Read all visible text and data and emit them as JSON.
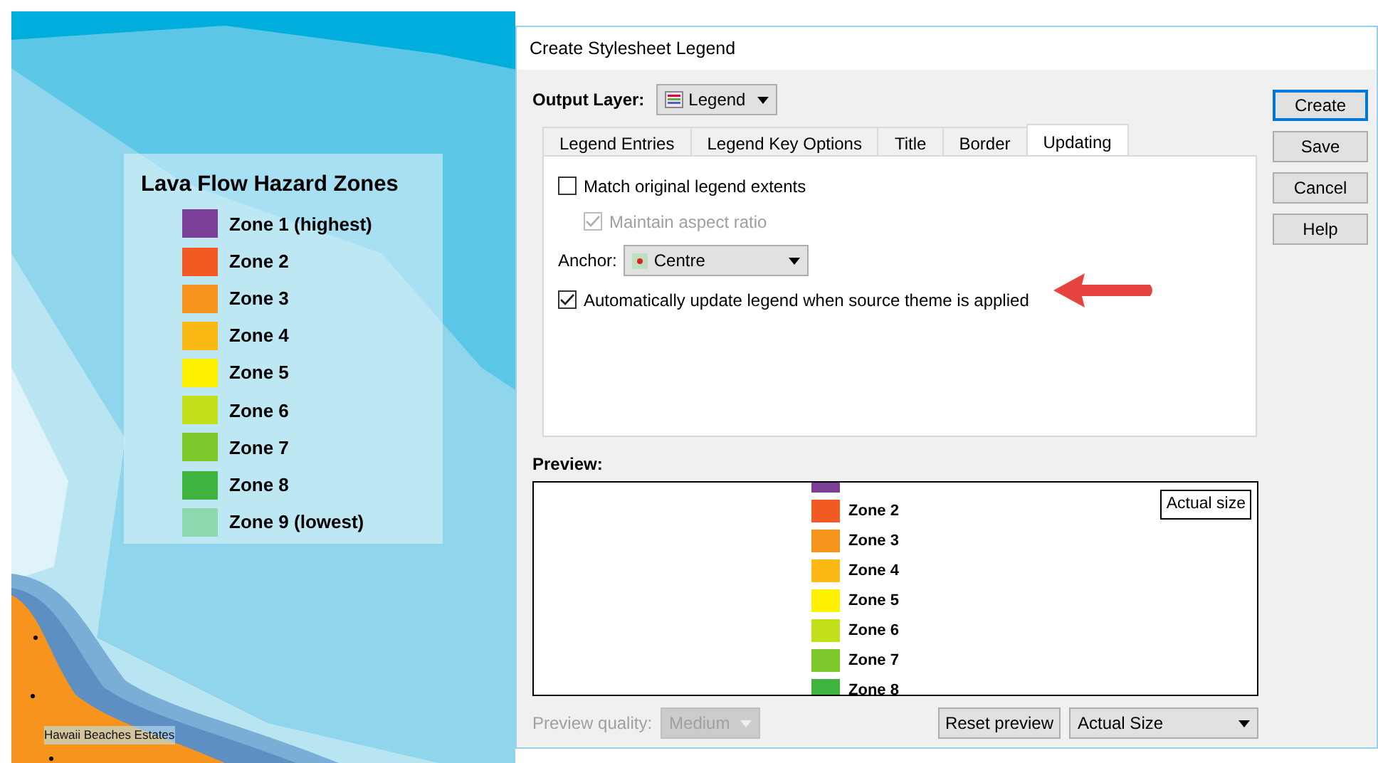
{
  "map": {
    "legend": {
      "title": "Lava Flow Hazard Zones",
      "entries": [
        {
          "label": "Zone 1 (highest)",
          "color": "#7b3f98"
        },
        {
          "label": "Zone 2",
          "color": "#f15a22"
        },
        {
          "label": "Zone 3",
          "color": "#f7941d"
        },
        {
          "label": "Zone 4",
          "color": "#fdb913"
        },
        {
          "label": "Zone 5",
          "color": "#fff200"
        },
        {
          "label": "Zone 6",
          "color": "#c2df19"
        },
        {
          "label": "Zone 7",
          "color": "#7dc92b"
        },
        {
          "label": "Zone 8",
          "color": "#3fb53f"
        },
        {
          "label": "Zone 9 (lowest)",
          "color": "#8ed8b0"
        }
      ]
    },
    "place_label": "Hawaii Beaches Estates"
  },
  "dialog": {
    "title": "Create Stylesheet Legend",
    "output_layer": {
      "label": "Output Layer:",
      "value": "Legend"
    },
    "tabs": [
      {
        "label": "Legend Entries",
        "selected": false
      },
      {
        "label": "Legend Key Options",
        "selected": false
      },
      {
        "label": "Title",
        "selected": false
      },
      {
        "label": "Border",
        "selected": false
      },
      {
        "label": "Updating",
        "selected": true
      }
    ],
    "options": [
      {
        "kind": "checkbox",
        "label": "Match original legend extents",
        "checked": false,
        "disabled": false,
        "indented": false
      },
      {
        "kind": "checkbox",
        "label": "Maintain aspect ratio",
        "checked": true,
        "disabled": true,
        "indented": true
      },
      {
        "kind": "select",
        "label": "Anchor:",
        "value": "Centre"
      },
      {
        "kind": "checkbox",
        "label": "Automatically update legend when source theme is applied",
        "checked": true,
        "disabled": false,
        "indented": false,
        "annotated": true
      }
    ],
    "preview": {
      "label": "Preview:",
      "badge": "Actual size",
      "entries": [
        {
          "color": "#7b3f98"
        },
        {
          "label": "Zone 2",
          "color": "#f15a22"
        },
        {
          "label": "Zone 3",
          "color": "#f7941d"
        },
        {
          "label": "Zone 4",
          "color": "#fdb913"
        },
        {
          "label": "Zone 5",
          "color": "#fff200"
        },
        {
          "label": "Zone 6",
          "color": "#c2df19"
        },
        {
          "label": "Zone 7",
          "color": "#7dc92b"
        },
        {
          "label": "Zone 8",
          "color": "#3fb53f"
        }
      ]
    },
    "preview_quality": {
      "label": "Preview quality:",
      "value": "Medium",
      "disabled": true
    },
    "reset_button": "Reset preview",
    "size_select": "Actual Size",
    "buttons": [
      {
        "label": "Create",
        "default": true
      },
      {
        "label": "Save",
        "default": false
      },
      {
        "label": "Cancel",
        "default": false
      },
      {
        "label": "Help",
        "default": false
      }
    ]
  }
}
